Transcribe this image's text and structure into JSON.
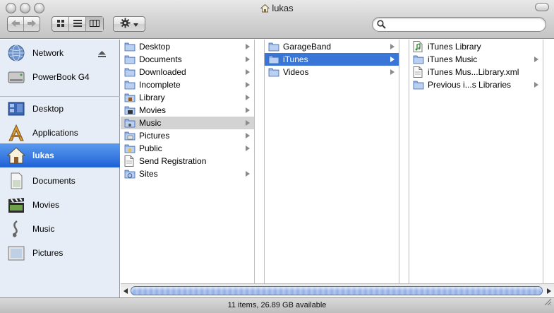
{
  "window": {
    "title": "lukas"
  },
  "search": {
    "value": "",
    "placeholder": ""
  },
  "sidebar": {
    "items": [
      {
        "label": "Network",
        "icon": "network-globe-icon",
        "eject": true
      },
      {
        "label": "PowerBook G4",
        "icon": "hard-drive-icon"
      },
      {
        "label": "Desktop",
        "icon": "desktop-icon"
      },
      {
        "label": "Applications",
        "icon": "applications-icon"
      },
      {
        "label": "lukas",
        "icon": "home-icon",
        "selected": true
      },
      {
        "label": "Documents",
        "icon": "documents-icon"
      },
      {
        "label": "Movies",
        "icon": "movies-icon"
      },
      {
        "label": "Music",
        "icon": "music-icon"
      },
      {
        "label": "Pictures",
        "icon": "pictures-icon"
      }
    ]
  },
  "columns": [
    {
      "items": [
        {
          "label": "Desktop",
          "icon": "folder-icon",
          "arrow": true
        },
        {
          "label": "Documents",
          "icon": "folder-icon",
          "arrow": true
        },
        {
          "label": "Downloaded",
          "icon": "folder-icon",
          "arrow": true
        },
        {
          "label": "Incomplete",
          "icon": "folder-icon",
          "arrow": true
        },
        {
          "label": "Library",
          "icon": "library-folder-icon",
          "arrow": true
        },
        {
          "label": "Movies",
          "icon": "movies-folder-icon",
          "arrow": true
        },
        {
          "label": "Music",
          "icon": "music-folder-icon",
          "arrow": true,
          "selected": "grey"
        },
        {
          "label": "Pictures",
          "icon": "pictures-folder-icon",
          "arrow": true
        },
        {
          "label": "Public",
          "icon": "public-folder-icon",
          "arrow": true
        },
        {
          "label": "Send Registration",
          "icon": "document-icon",
          "arrow": false
        },
        {
          "label": "Sites",
          "icon": "sites-folder-icon",
          "arrow": true
        }
      ]
    },
    {
      "items": [
        {
          "label": "GarageBand",
          "icon": "folder-icon",
          "arrow": true
        },
        {
          "label": "iTunes",
          "icon": "folder-icon",
          "arrow": true,
          "selected": "blue"
        },
        {
          "label": "Videos",
          "icon": "folder-icon",
          "arrow": true
        }
      ]
    },
    {
      "items": [
        {
          "label": "iTunes Library",
          "icon": "itunes-library-file-icon",
          "arrow": false
        },
        {
          "label": "iTunes Music",
          "icon": "folder-icon",
          "arrow": true
        },
        {
          "label": "iTunes Mus...Library.xml",
          "icon": "xml-document-icon",
          "arrow": false
        },
        {
          "label": "Previous i...s Libraries",
          "icon": "folder-icon",
          "arrow": true
        }
      ]
    }
  ],
  "status": {
    "text": "11 items, 26.89 GB available"
  },
  "colors": {
    "selection_blue": "#3875d7",
    "sidebar_bg": "#e7edf6",
    "sidebar_selected": "#1f61d8"
  }
}
